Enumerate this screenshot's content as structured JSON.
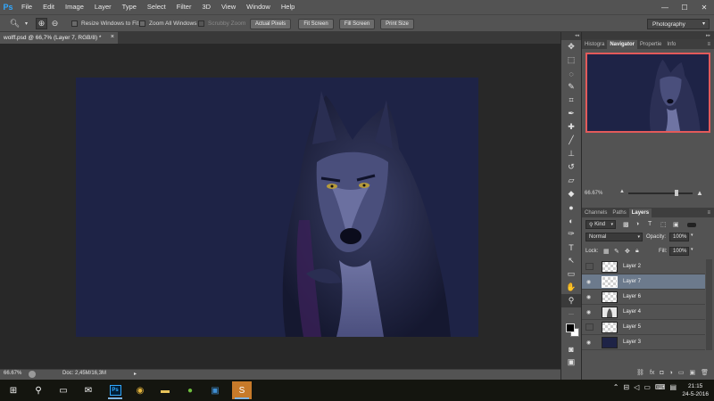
{
  "app": {
    "logo": "Ps"
  },
  "menu": [
    "File",
    "Edit",
    "Image",
    "Layer",
    "Type",
    "Select",
    "Filter",
    "3D",
    "View",
    "Window",
    "Help"
  ],
  "window_controls": {
    "minimize": "—",
    "maximize": "☐",
    "close": "✕"
  },
  "options_bar": {
    "resize_windows": "Resize Windows to Fit",
    "zoom_all": "Zoom All Windows",
    "scrubby_zoom": "Scrubby Zoom",
    "actual_pixels": "Actual Pixels",
    "fit_screen": "Fit Screen",
    "fill_screen": "Fill Screen",
    "print_size": "Print Size",
    "workspace": "Photography"
  },
  "document": {
    "tab": "wolff.psd @ 66,7% (Layer 7, RGB/8) *",
    "close": "×"
  },
  "status": {
    "zoom": "66.67%",
    "doc": "Doc: 2,45M/16,3M",
    "arrow": "▸"
  },
  "navigator": {
    "tabs": [
      "Histogra",
      "Navigator",
      "Propertie",
      "Info"
    ],
    "active_tab": "Navigator",
    "zoom": "66.67%"
  },
  "layers_panel": {
    "tabs": [
      "Channels",
      "Paths",
      "Layers"
    ],
    "active_tab": "Layers",
    "kind_label": "Kind",
    "blend_mode": "Normal",
    "opacity_label": "Opacity:",
    "opacity": "100%",
    "lock_label": "Lock:",
    "fill_label": "Fill:",
    "fill": "100%",
    "layers": [
      {
        "name": "Layer 2",
        "visible": false,
        "selected": false,
        "thumb": "transparent"
      },
      {
        "name": "Layer 7",
        "visible": true,
        "selected": true,
        "thumb": "transparent"
      },
      {
        "name": "Layer 6",
        "visible": true,
        "selected": false,
        "thumb": "transparent"
      },
      {
        "name": "Layer 4",
        "visible": true,
        "selected": false,
        "thumb": "sketch"
      },
      {
        "name": "Layer 5",
        "visible": false,
        "selected": false,
        "thumb": "transparent"
      },
      {
        "name": "Layer 3",
        "visible": true,
        "selected": false,
        "thumb": "navy"
      }
    ]
  },
  "taskbar": {
    "time": "21:15",
    "date": "24-5-2016"
  },
  "colors": {
    "canvas_bg": "#1e2346",
    "nav_border": "#e35a5a",
    "selected_layer": "#6c7a8c"
  }
}
